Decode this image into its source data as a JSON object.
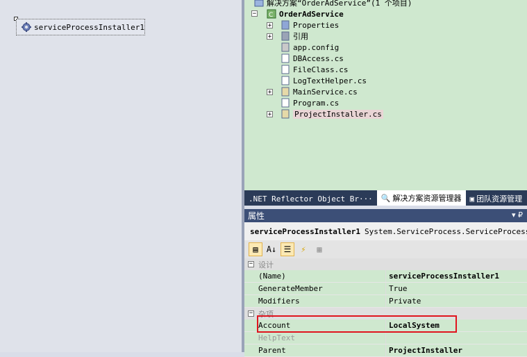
{
  "designer": {
    "component_label": "serviceProcessInstaller1"
  },
  "solution_explorer": {
    "solution_label": "解决方案“OrderAdService”(1 个项目)",
    "project_label": "OrderAdService",
    "items": [
      {
        "label": "Properties",
        "icon": "properties-folder-icon",
        "expandable": true
      },
      {
        "label": "引用",
        "icon": "references-folder-icon",
        "expandable": true
      },
      {
        "label": "app.config",
        "icon": "config-file-icon",
        "expandable": false
      },
      {
        "label": "DBAccess.cs",
        "icon": "cs-file-icon",
        "expandable": false
      },
      {
        "label": "FileClass.cs",
        "icon": "cs-file-icon",
        "expandable": false
      },
      {
        "label": "LogTextHelper.cs",
        "icon": "cs-file-icon",
        "expandable": false
      },
      {
        "label": "MainService.cs",
        "icon": "service-file-icon",
        "expandable": true
      },
      {
        "label": "Program.cs",
        "icon": "cs-file-icon",
        "expandable": false
      },
      {
        "label": "ProjectInstaller.cs",
        "icon": "service-file-icon",
        "expandable": true
      }
    ]
  },
  "tabs": [
    {
      "label": ".NET Reflector Object Br···"
    },
    {
      "label": "解决方案资源管理器"
    },
    {
      "label": "团队资源管理"
    }
  ],
  "properties": {
    "header": "属性",
    "pin": "▾ ₽",
    "object_name": "serviceProcessInstaller1",
    "object_type": "System.ServiceProcess.ServiceProcessIn",
    "categories": [
      {
        "name": "设计",
        "rows": [
          {
            "name": "(Name)",
            "value": "serviceProcessInstaller1",
            "bold": true
          },
          {
            "name": "GenerateMember",
            "value": "True",
            "bold": false
          },
          {
            "name": "Modifiers",
            "value": "Private",
            "bold": false
          }
        ]
      },
      {
        "name": "杂项",
        "rows": [
          {
            "name": "Account",
            "value": "LocalSystem",
            "bold": true
          },
          {
            "name": "HelpText",
            "value": "",
            "bold": false,
            "dim": true
          },
          {
            "name": "Parent",
            "value": "ProjectInstaller",
            "bold": true
          }
        ]
      }
    ]
  },
  "colors": {
    "highlight": "#e0141e",
    "selection_green": "#cfe8cf",
    "header_blue": "#3c4f77"
  }
}
